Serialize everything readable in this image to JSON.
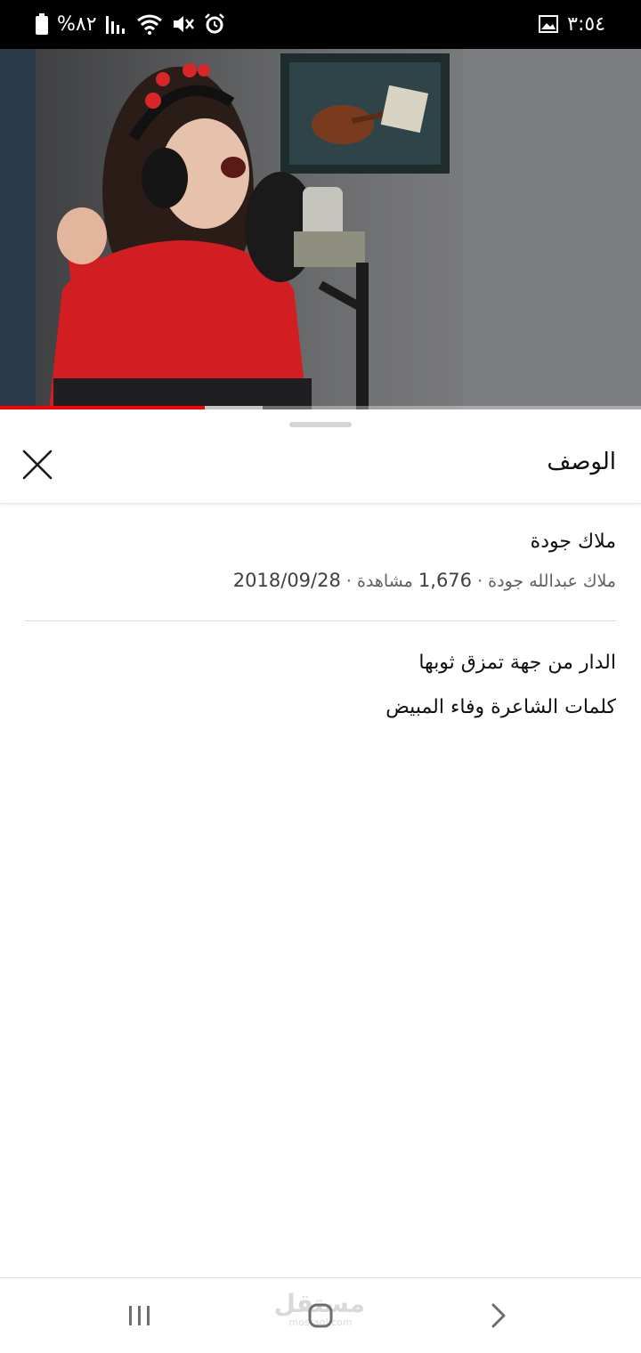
{
  "status_bar": {
    "time": "٣:٥٤",
    "battery": "%٨٢",
    "icons": [
      "battery-icon",
      "signal-icon",
      "wifi-icon",
      "mute-icon",
      "alarm-icon",
      "gallery-icon"
    ]
  },
  "video": {
    "progress": 0.32,
    "buffered": 0.41,
    "accent_color": "#ff0000"
  },
  "sheet": {
    "title": "الوصف",
    "close_icon": "close-icon"
  },
  "details": {
    "video_title": "ملاك جودة",
    "channel": "ملاك عبدالله جودة",
    "views_count": "1,676",
    "views_label": "مشاهدة",
    "date": "2018/09/28",
    "separator": "·"
  },
  "description": {
    "lines": [
      "الدار من جهة تمزق ثوبها",
      "كلمات الشاعرة وفاء المبيض"
    ]
  },
  "nav": {
    "recents_icon": "recents-icon",
    "home_icon": "home-icon",
    "back_icon": "back-icon"
  },
  "watermark": {
    "main": "مستقل",
    "sub": "mostaql.com"
  }
}
